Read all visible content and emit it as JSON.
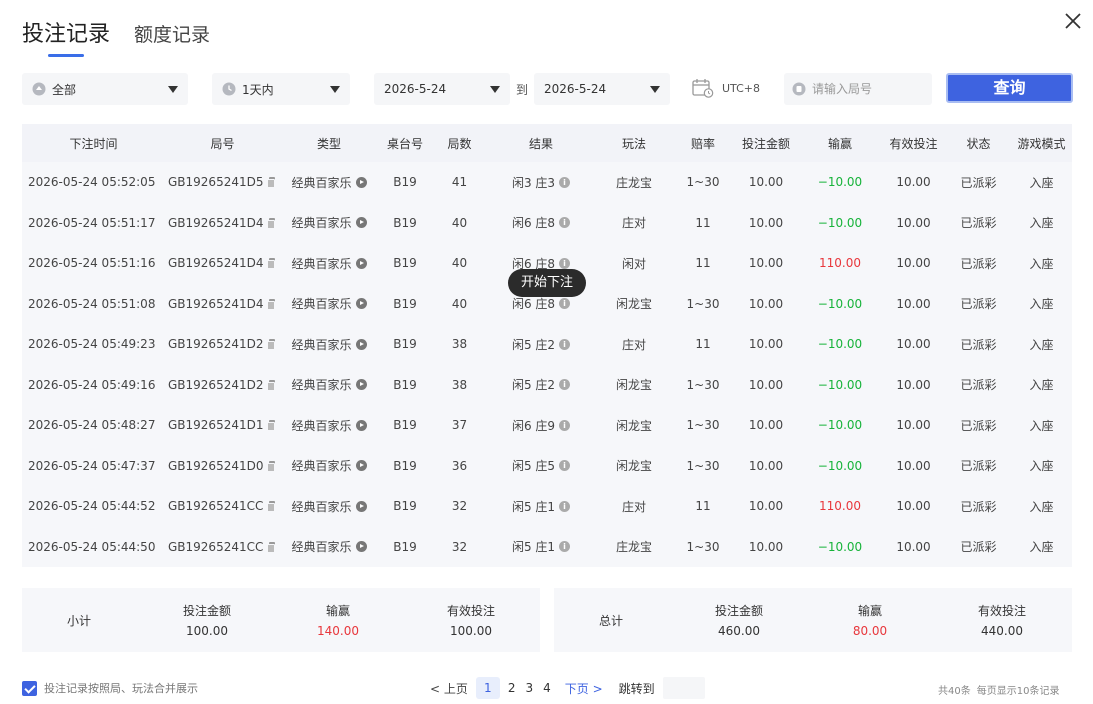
{
  "tabs": {
    "active": "投注记录",
    "inactive": "额度记录"
  },
  "filters": {
    "type": "全部",
    "period": "1天内",
    "date_from": "2026-5-24",
    "to_label": "到",
    "date_to": "2026-5-24",
    "timezone": "UTC+8",
    "search_placeholder": "请输入局号",
    "query_label": "查询"
  },
  "table": {
    "headers": [
      "下注时间",
      "局号",
      "类型",
      "桌台号",
      "局数",
      "结果",
      "玩法",
      "赔率",
      "投注金额",
      "输赢",
      "有效投注",
      "状态",
      "游戏模式"
    ],
    "rows": [
      {
        "time": "2026-05-24 05:52:05",
        "round": "GB19265241D5",
        "type": "经典百家乐",
        "table": "B19",
        "count": "41",
        "result": "闲3 庄3",
        "play": "庄龙宝",
        "odds": "1~30",
        "amount": "10.00",
        "win": "−10.00",
        "win_sign": "neg",
        "valid": "10.00",
        "status": "已派彩",
        "mode": "入座"
      },
      {
        "time": "2026-05-24 05:51:17",
        "round": "GB19265241D4",
        "type": "经典百家乐",
        "table": "B19",
        "count": "40",
        "result": "闲6 庄8",
        "play": "庄对",
        "odds": "11",
        "amount": "10.00",
        "win": "−10.00",
        "win_sign": "neg",
        "valid": "10.00",
        "status": "已派彩",
        "mode": "入座"
      },
      {
        "time": "2026-05-24 05:51:16",
        "round": "GB19265241D4",
        "type": "经典百家乐",
        "table": "B19",
        "count": "40",
        "result": "闲6 庄8",
        "play": "闲对",
        "odds": "11",
        "amount": "10.00",
        "win": "110.00",
        "win_sign": "pos",
        "valid": "10.00",
        "status": "已派彩",
        "mode": "入座"
      },
      {
        "time": "2026-05-24 05:51:08",
        "round": "GB19265241D4",
        "type": "经典百家乐",
        "table": "B19",
        "count": "40",
        "result": "闲6 庄8",
        "play": "闲龙宝",
        "odds": "1~30",
        "amount": "10.00",
        "win": "−10.00",
        "win_sign": "neg",
        "valid": "10.00",
        "status": "已派彩",
        "mode": "入座"
      },
      {
        "time": "2026-05-24 05:49:23",
        "round": "GB19265241D2",
        "type": "经典百家乐",
        "table": "B19",
        "count": "38",
        "result": "闲5 庄2",
        "play": "庄对",
        "odds": "11",
        "amount": "10.00",
        "win": "−10.00",
        "win_sign": "neg",
        "valid": "10.00",
        "status": "已派彩",
        "mode": "入座"
      },
      {
        "time": "2026-05-24 05:49:16",
        "round": "GB19265241D2",
        "type": "经典百家乐",
        "table": "B19",
        "count": "38",
        "result": "闲5 庄2",
        "play": "闲龙宝",
        "odds": "1~30",
        "amount": "10.00",
        "win": "−10.00",
        "win_sign": "neg",
        "valid": "10.00",
        "status": "已派彩",
        "mode": "入座"
      },
      {
        "time": "2026-05-24 05:48:27",
        "round": "GB19265241D1",
        "type": "经典百家乐",
        "table": "B19",
        "count": "37",
        "result": "闲6 庄9",
        "play": "闲龙宝",
        "odds": "1~30",
        "amount": "10.00",
        "win": "−10.00",
        "win_sign": "neg",
        "valid": "10.00",
        "status": "已派彩",
        "mode": "入座"
      },
      {
        "time": "2026-05-24 05:47:37",
        "round": "GB19265241D0",
        "type": "经典百家乐",
        "table": "B19",
        "count": "36",
        "result": "闲5 庄5",
        "play": "闲龙宝",
        "odds": "1~30",
        "amount": "10.00",
        "win": "−10.00",
        "win_sign": "neg",
        "valid": "10.00",
        "status": "已派彩",
        "mode": "入座"
      },
      {
        "time": "2026-05-24 05:44:52",
        "round": "GB19265241CC",
        "type": "经典百家乐",
        "table": "B19",
        "count": "32",
        "result": "闲5 庄1",
        "play": "庄对",
        "odds": "11",
        "amount": "10.00",
        "win": "110.00",
        "win_sign": "pos",
        "valid": "10.00",
        "status": "已派彩",
        "mode": "入座"
      },
      {
        "time": "2026-05-24 05:44:50",
        "round": "GB19265241CC",
        "type": "经典百家乐",
        "table": "B19",
        "count": "32",
        "result": "闲5 庄1",
        "play": "庄龙宝",
        "odds": "1~30",
        "amount": "10.00",
        "win": "−10.00",
        "win_sign": "neg",
        "valid": "10.00",
        "status": "已派彩",
        "mode": "入座"
      }
    ]
  },
  "tooltip": "开始下注",
  "subtotal": {
    "title": "小计",
    "amount_label": "投注金额",
    "amount": "100.00",
    "win_label": "输赢",
    "win": "140.00",
    "valid_label": "有效投注",
    "valid": "100.00"
  },
  "total": {
    "title": "总计",
    "amount_label": "投注金额",
    "amount": "460.00",
    "win_label": "输赢",
    "win": "80.00",
    "valid_label": "有效投注",
    "valid": "440.00"
  },
  "footer": {
    "merge_label": "投注记录按照局、玩法合并展示",
    "prev": "< 上页",
    "pages": [
      "1",
      "2",
      "3",
      "4"
    ],
    "active_page": "1",
    "next": "下页 >",
    "jump_label": "跳转到",
    "total_count": "共40条",
    "per_page": "每页显示10条记录"
  },
  "colors": {
    "accent": "#3e63e0",
    "loss": "#17b33a",
    "win": "#e8373c"
  }
}
